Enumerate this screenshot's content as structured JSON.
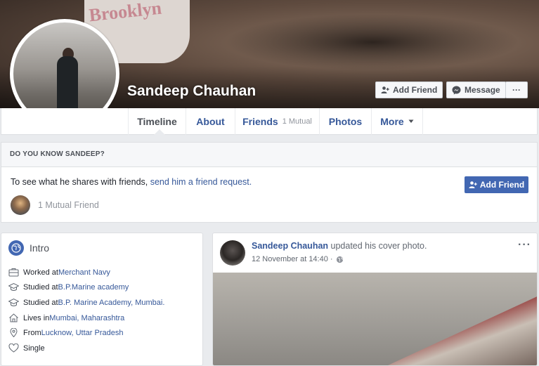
{
  "profile": {
    "name": "Sandeep Chauhan",
    "buttons": {
      "add_friend": "Add Friend",
      "message": "Message",
      "more": "···"
    }
  },
  "tabs": [
    {
      "label": "Timeline"
    },
    {
      "label": "About"
    },
    {
      "label": "Friends",
      "sub": "1 Mutual"
    },
    {
      "label": "Photos"
    },
    {
      "label": "More"
    }
  ],
  "know": {
    "heading": "DO YOU KNOW SANDEEP?",
    "message_prefix": "To see what he shares with friends, ",
    "message_link": "send him a friend request.",
    "mutual": "1 Mutual Friend",
    "add_friend": "Add Friend"
  },
  "intro": {
    "title": "Intro",
    "items": [
      {
        "icon": "briefcase-icon",
        "prefix": "Worked at ",
        "link": "Merchant Navy"
      },
      {
        "icon": "graduation-cap-icon",
        "prefix": "Studied at ",
        "link": "B.P.Marine academy"
      },
      {
        "icon": "graduation-cap-icon",
        "prefix": "Studied at ",
        "link": "B.P. Marine Academy, Mumbai."
      },
      {
        "icon": "home-icon",
        "prefix": "Lives in ",
        "link": "Mumbai, Maharashtra"
      },
      {
        "icon": "location-pin-icon",
        "prefix": "From ",
        "link": "Lucknow, Uttar Pradesh"
      },
      {
        "icon": "heart-icon",
        "prefix": "Single",
        "link": ""
      }
    ]
  },
  "post": {
    "author": "Sandeep Chauhan",
    "action": " updated his cover photo.",
    "timestamp": "12 November at 14:40 ·",
    "more": "···"
  },
  "colors": {
    "brand_blue": "#4267b2",
    "link": "#365899"
  }
}
